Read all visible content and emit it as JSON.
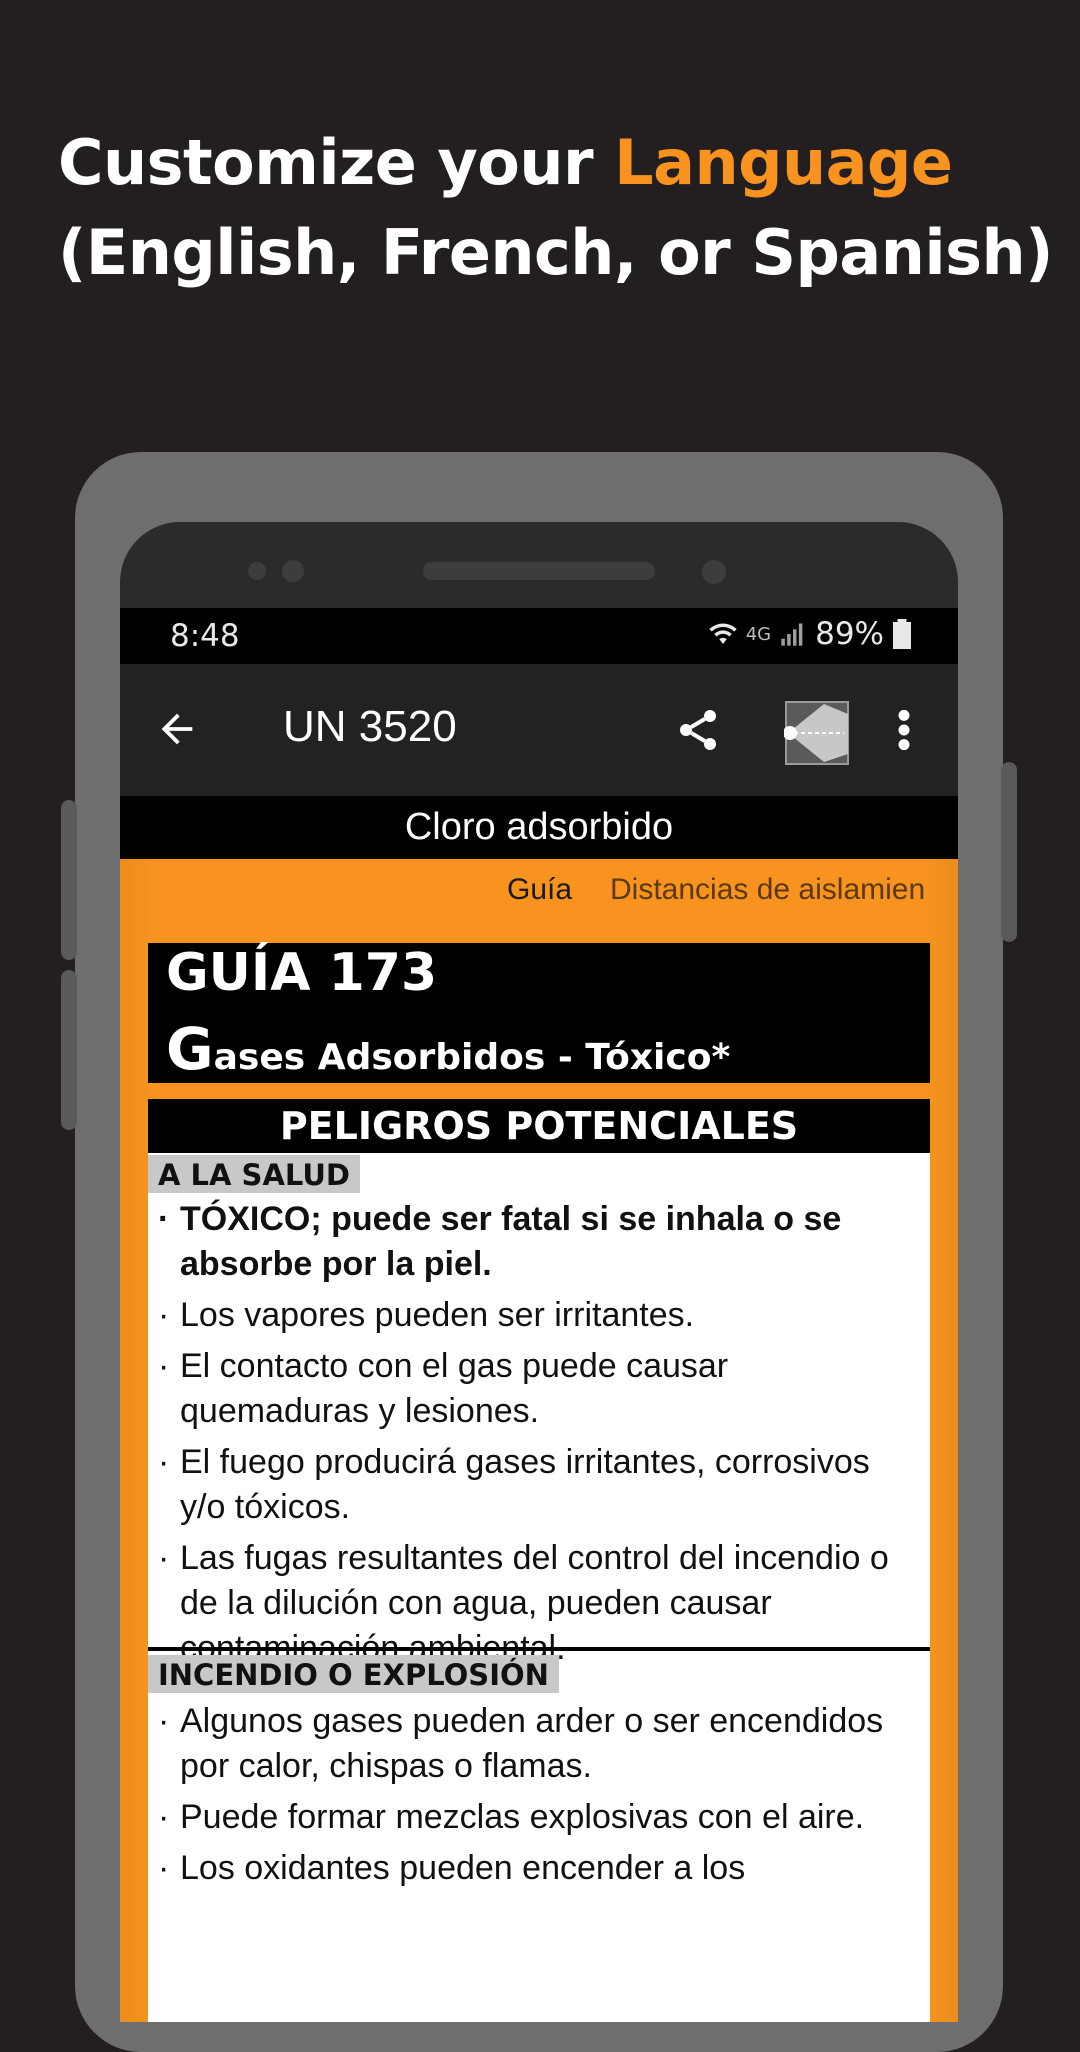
{
  "headline": {
    "line1_prefix": "Customize your ",
    "line1_accent": "Language",
    "line2": "(English, French, or Spanish)",
    "accent_color": "#f7931e"
  },
  "statusbar": {
    "time": "8:48",
    "network": "4G",
    "battery": "89%"
  },
  "appbar": {
    "title": "UN 3520",
    "back_icon": "arrow-back-icon",
    "share_icon": "share-icon",
    "ebook_icon": "guide-book-icon",
    "more_icon": "more-vert-icon"
  },
  "subtitle": "Cloro adsorbido",
  "tabs": [
    {
      "label": "Guía",
      "active": true
    },
    {
      "label": "Distancias de aislamien",
      "active": false
    }
  ],
  "guide": {
    "number": "GUÍA 173",
    "name_first_letter": "G",
    "name_rest": "ases Adsorbidos - Tóxico*"
  },
  "section": {
    "title": "PELIGROS POTENCIALES",
    "health": {
      "heading": "A LA SALUD",
      "items": [
        "TÓXICO; puede ser fatal si se inhala o se absorbe por la piel.",
        "Los vapores pueden ser irritantes.",
        "El contacto con el gas puede causar quemaduras y lesiones.",
        "El fuego producirá gases irritantes, corrosivos y/o tóxicos.",
        "Las fugas resultantes del control del incendio o de la dilución con agua, pueden causar contaminación ambiental."
      ]
    },
    "fire": {
      "heading": "INCENDIO O EXPLOSIÓN",
      "items": [
        "Algunos gases pueden arder o ser encendidos por calor, chispas o flamas.",
        "Puede formar mezclas explosivas con el aire.",
        "Los oxidantes pueden encender a los"
      ]
    }
  }
}
